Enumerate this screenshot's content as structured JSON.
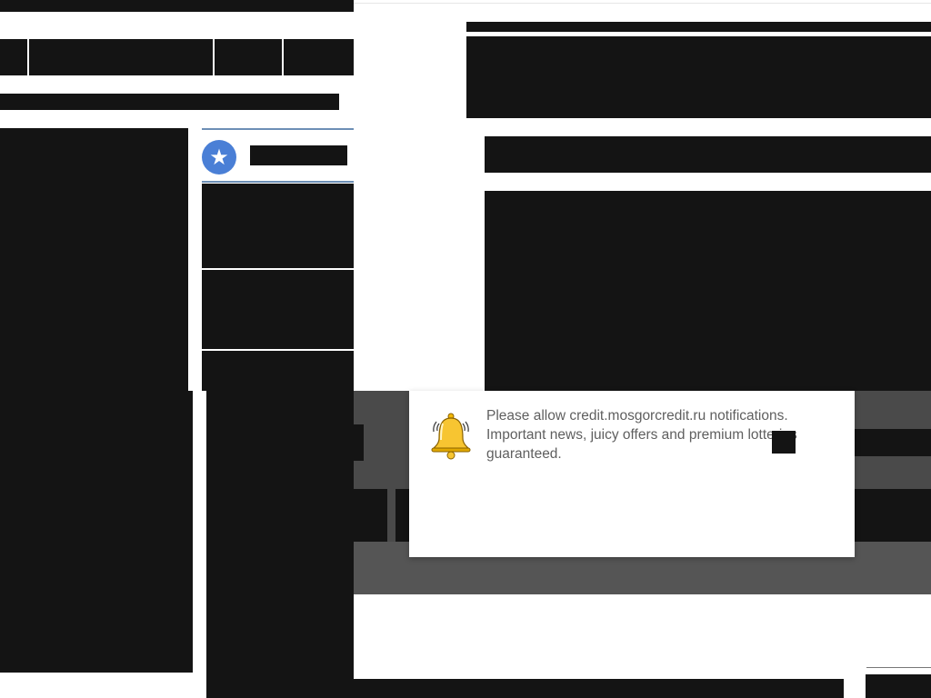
{
  "notification_prompt": {
    "line1": "Please allow credit.mosgorcredit.ru notifications.",
    "line2": "Important news, juicy offers and premium lotteries",
    "line3": "guaranteed.",
    "icon": "bell-icon"
  },
  "colors": {
    "redaction": "#141414",
    "accent_blue": "#4a7fd6",
    "backdrop": "#4a4a4a",
    "notification_text": "#5f5f5f",
    "selection_blue": "#1e88e5"
  },
  "icons": {
    "star": "star-icon"
  }
}
